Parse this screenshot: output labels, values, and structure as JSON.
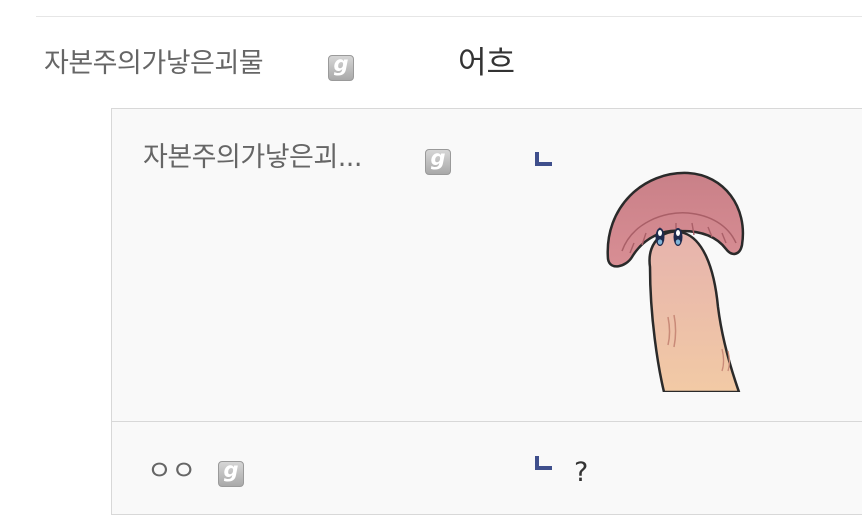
{
  "comment": {
    "nickname": "자본주의가낳은괴물",
    "nickname_icon": "gallog-icon",
    "text": "어흐"
  },
  "replies": [
    {
      "nickname": "자본주의가낳은괴...",
      "nickname_icon": "gallog-icon",
      "reply_icon": "reply-arrow-icon",
      "content_type": "dccon-sticker",
      "sticker": "mushroom-finger-sticker"
    },
    {
      "nickname": "ㅇㅇ",
      "nickname_icon": "gallog-icon",
      "reply_icon": "reply-arrow-icon",
      "text": "?"
    }
  ],
  "colors": {
    "reply_arrow": "#3f4f8c",
    "reply_bg": "#f9f9f9",
    "border": "#d8d8d8"
  }
}
